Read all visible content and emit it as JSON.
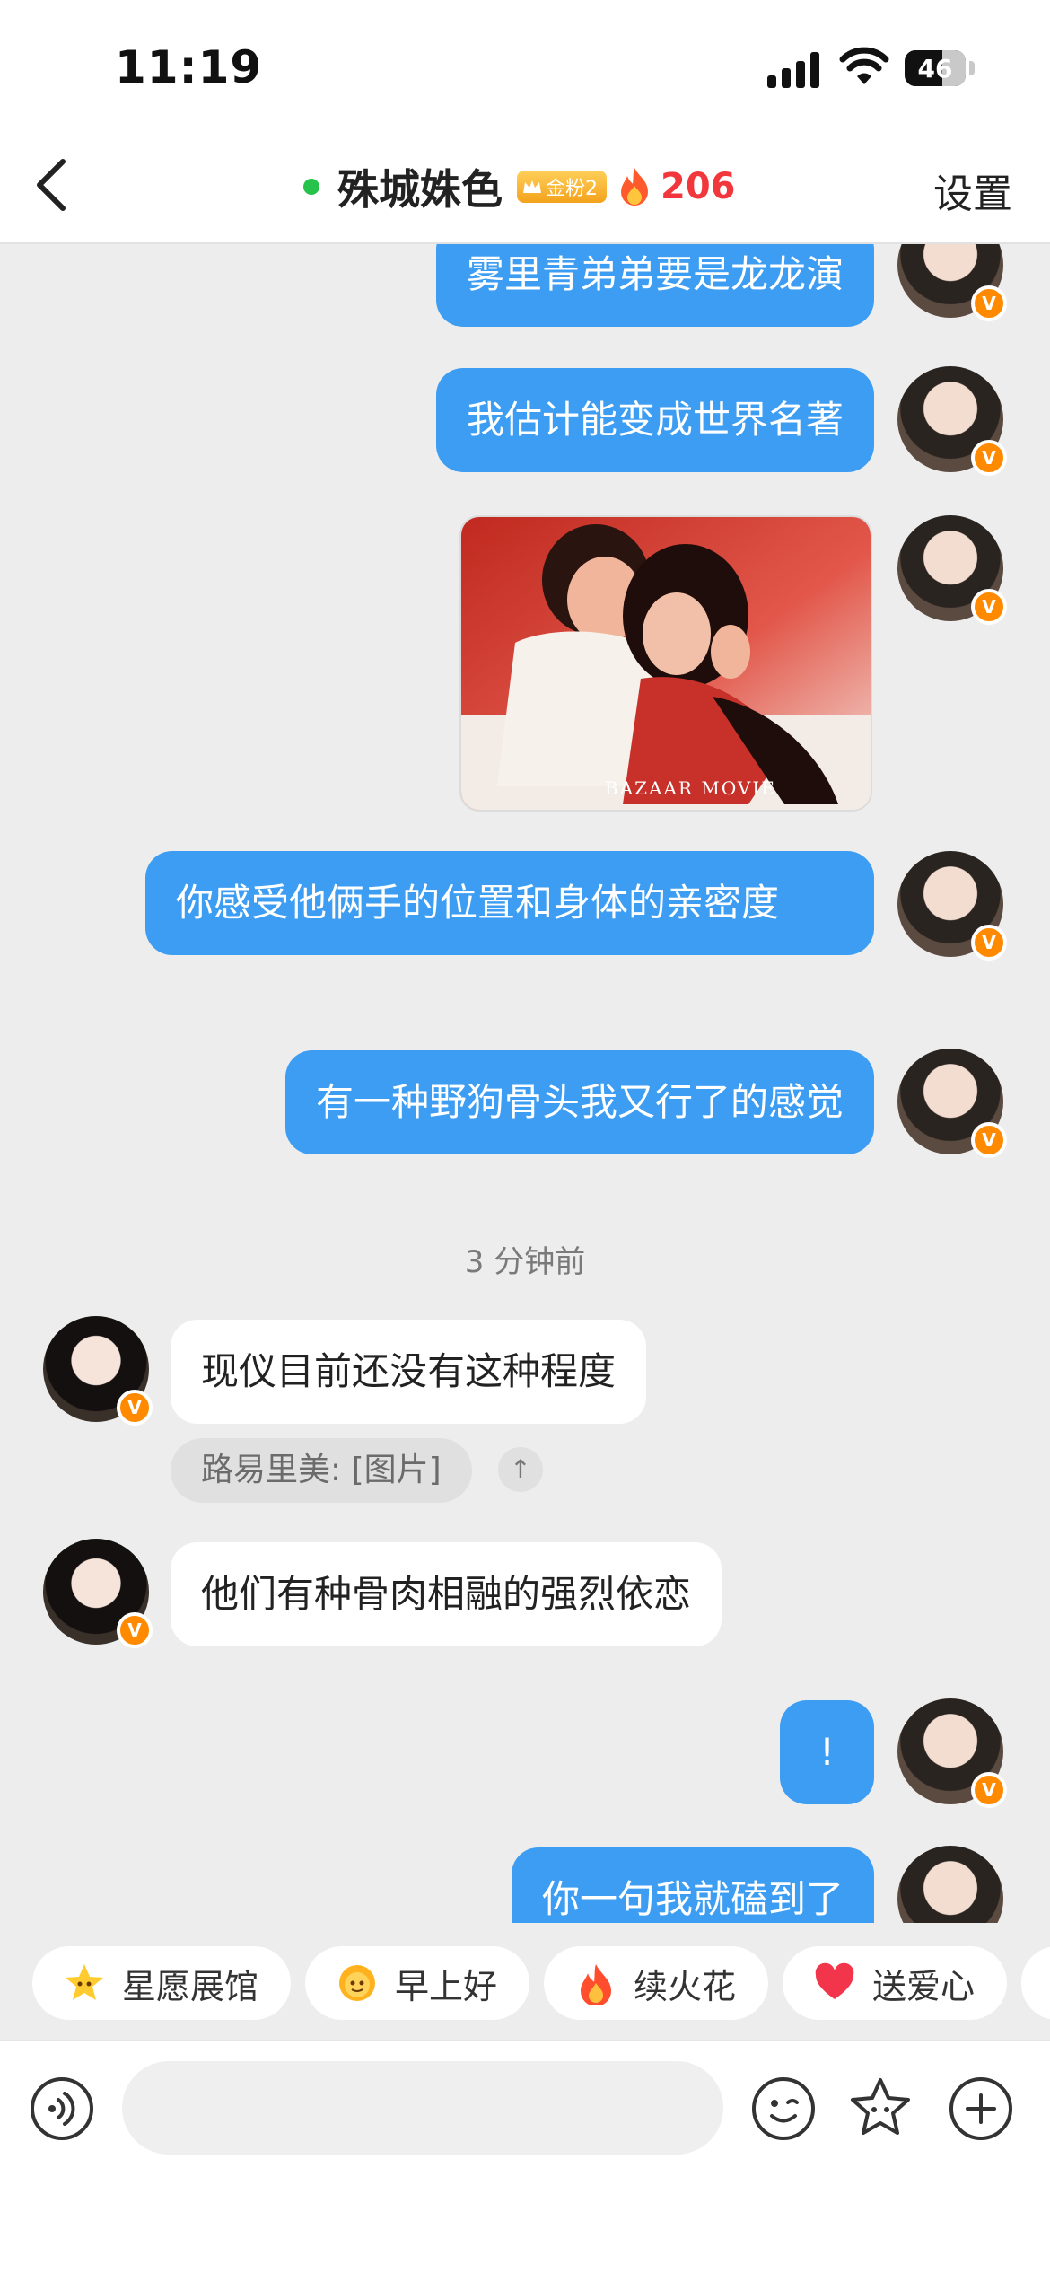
{
  "status_bar": {
    "time": "11:19",
    "battery": "46"
  },
  "header": {
    "title": "殊城姝色",
    "fan_badge": "金粉2",
    "fire_count": "206",
    "settings_label": "设置"
  },
  "messages": [
    {
      "text": "雾里青弟弟要是龙龙演"
    },
    {
      "text": "我估计能变成世界名著"
    },
    {
      "type": "image",
      "watermark": "BAZAAR MOVIE"
    },
    {
      "text": "你感受他俩手的位置和身体的亲密度"
    },
    {
      "text": "有一种野狗骨头我又行了的感觉"
    },
    {
      "timestamp": "3 分钟前"
    },
    {
      "text": "现仪目前还没有这种程度",
      "quote": "路易里美: [图片]",
      "quote_jump": "↑"
    },
    {
      "text": "他们有种骨肉相融的强烈依恋"
    },
    {
      "text": "!"
    },
    {
      "text": "你一句我就磕到了"
    }
  ],
  "shortcuts": [
    {
      "label": "星愿展馆",
      "icon": "star-face-icon"
    },
    {
      "label": "早上好",
      "icon": "sun-face-icon"
    },
    {
      "label": "续火花",
      "icon": "fire-icon"
    },
    {
      "label": "送爱心",
      "icon": "heart-icon"
    }
  ],
  "input": {
    "placeholder": ""
  },
  "colors": {
    "my_bubble": "#3c9df2",
    "fire": "#f2373c",
    "verified": "#ff8a00",
    "online": "#27c24c"
  }
}
